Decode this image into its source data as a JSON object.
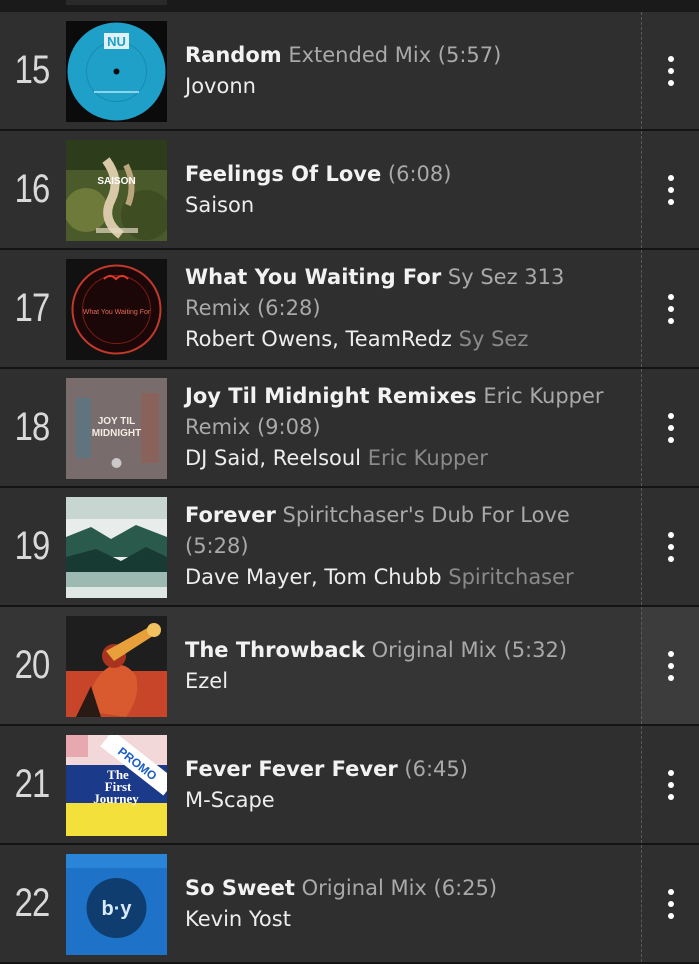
{
  "tracks": [
    {
      "number": "15",
      "title": "Random",
      "mix": "Extended Mix (5:57)",
      "artists": "Jovonn",
      "remixer": ""
    },
    {
      "number": "16",
      "title": "Feelings Of Love",
      "mix": "(6:08)",
      "artists": "Saison",
      "remixer": ""
    },
    {
      "number": "17",
      "title": "What You Waiting For",
      "mix": "Sy Sez 313 Remix (6:28)",
      "artists": "Robert Owens, TeamRedz",
      "remixer": "Sy Sez"
    },
    {
      "number": "18",
      "title": "Joy Til Midnight Remixes",
      "mix": "Eric Kupper Remix (9:08)",
      "artists": "DJ Said, Reelsoul",
      "remixer": "Eric Kupper"
    },
    {
      "number": "19",
      "title": "Forever",
      "mix": "Spiritchaser's Dub For Love (5:28)",
      "artists": "Dave Mayer, Tom Chubb",
      "remixer": "Spiritchaser"
    },
    {
      "number": "20",
      "title": "The Throwback",
      "mix": "Original Mix (5:32)",
      "artists": "Ezel",
      "remixer": ""
    },
    {
      "number": "21",
      "title": "Fever Fever Fever",
      "mix": "(6:45)",
      "artists": "M-Scape",
      "remixer": ""
    },
    {
      "number": "22",
      "title": "So Sweet",
      "mix": "Original Mix (6:25)",
      "artists": "Kevin Yost",
      "remixer": ""
    }
  ],
  "artwork_text": {
    "t15_logo": "NU",
    "t16_label": "SAISON",
    "t17_title": "What You Waiting For",
    "t18_title1": "JOY TIL",
    "t18_title2": "MIDNIGHT",
    "t21_promo": "PROMO",
    "t21_line1": "The",
    "t21_line2": "First",
    "t21_line3": "Journey",
    "t22_logo": "b·y"
  },
  "icons": {
    "menu": "more-vertical-icon"
  },
  "colors": {
    "row": "#2f2f2f",
    "row_alt": "#353535",
    "title": "#f2f2f2",
    "secondary": "#a9a9a9",
    "remixer": "#8a8a8a"
  }
}
